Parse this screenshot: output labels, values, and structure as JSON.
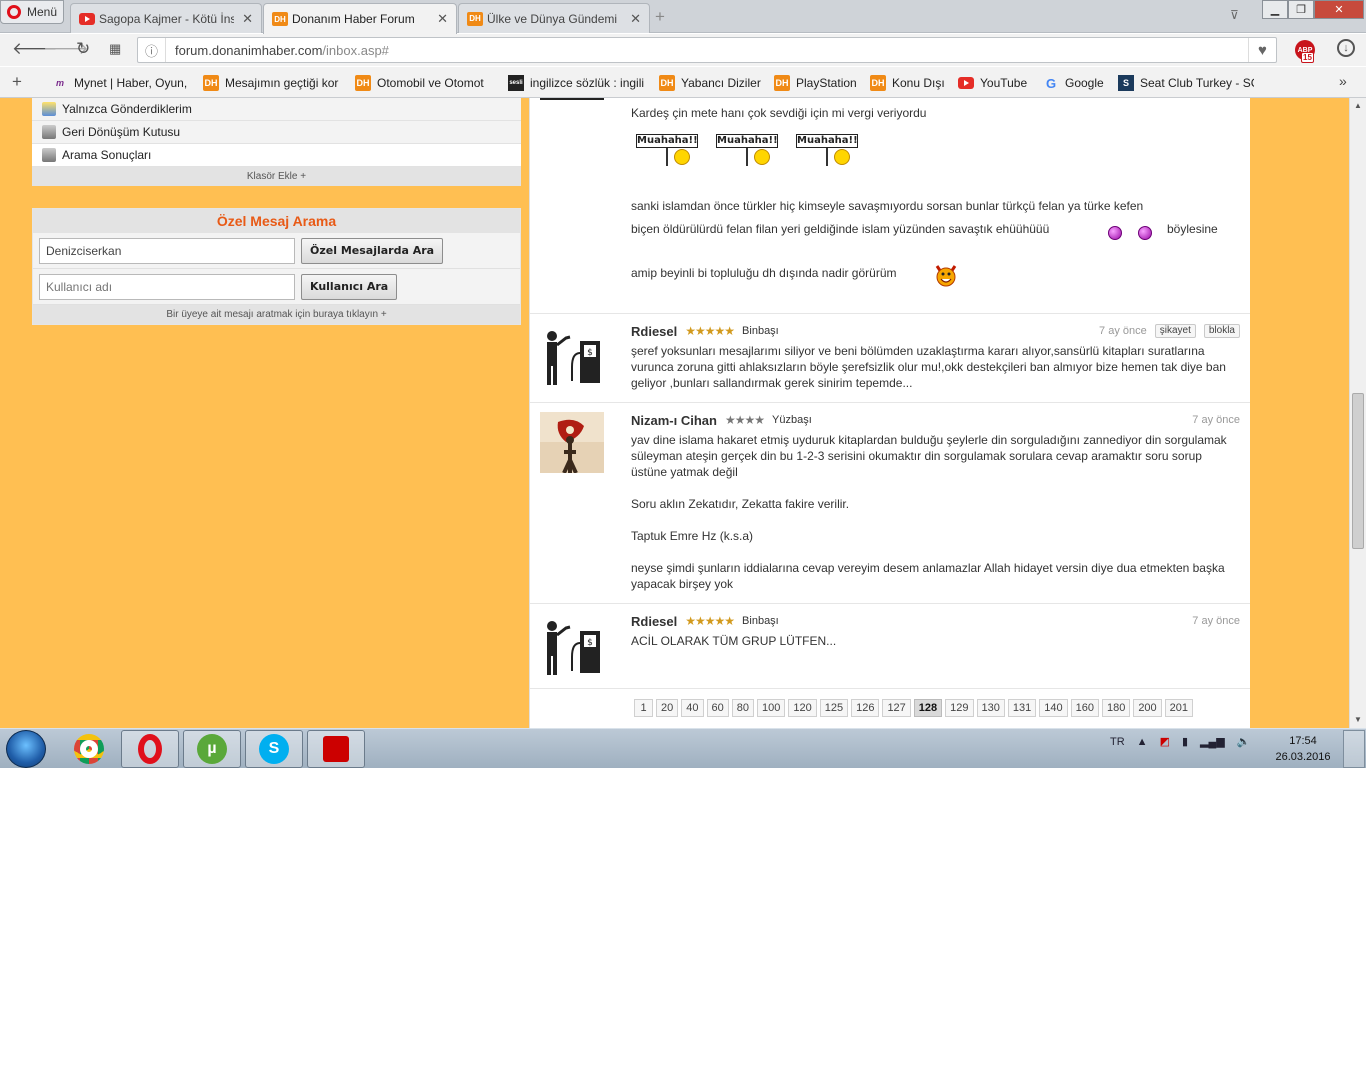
{
  "browser": {
    "menu_label": "Menü",
    "tabs": [
      {
        "label": "Sagopa Kajmer - Kötü İnsa",
        "icon": "youtube-icon"
      },
      {
        "label": "Donanım Haber Forum",
        "icon": "dh-icon",
        "active": true
      },
      {
        "label": "Ülke ve Dünya Gündemi",
        "icon": "dh-icon"
      }
    ],
    "address": {
      "host": "forum.donanimhaber.com",
      "path": "/inbox.asp#"
    },
    "adblock_count": "15",
    "bookmarks": [
      {
        "label": "Mynet | Haber, Oyun,",
        "icon": "mynet-icon"
      },
      {
        "label": "Mesajımın geçtiği kor",
        "icon": "dh-icon"
      },
      {
        "label": "Otomobil ve Otomot",
        "icon": "dh-icon"
      },
      {
        "label": "ingilizce sözlük : ingili",
        "icon": "seslisozluk-icon"
      },
      {
        "label": "Yabancı Diziler",
        "icon": "dh-icon"
      },
      {
        "label": "PlayStation",
        "icon": "dh-icon"
      },
      {
        "label": "Konu Dışı",
        "icon": "dh-icon"
      },
      {
        "label": "YouTube",
        "icon": "youtube-icon"
      },
      {
        "label": "Google",
        "icon": "google-icon"
      },
      {
        "label": "Seat Club Turkey - SC",
        "icon": "seat-icon"
      }
    ]
  },
  "sidebar": {
    "folders": [
      "Yalnızca Gönderdiklerim",
      "Geri Dönüşüm Kutusu",
      "Arama Sonuçları"
    ],
    "add_folder": "Klasör Ekle +",
    "search": {
      "title": "Özel Mesaj Arama",
      "query_value": "Denizciserkan",
      "search_button": "Özel Mesajlarda Ara",
      "user_placeholder": "Kullanıcı adı",
      "user_button": "Kullanıcı Ara",
      "hint": "Bir üyeye ait mesajı aratmak için buraya tıklayın +"
    }
  },
  "messages": [
    {
      "text_lines": [
        "Kardeş çin mete hanı çok sevdiği için mi vergi veriyordu",
        "sanki islamdan önce türkler hiç kimseyle savaşmıyordu sorsan bunlar türkçü felan ya türke kefen",
        "biçen öldürülürdü felan filan yeri geldiğinde islam yüzünden savaştık ehüühüüü",
        "böylesine",
        "amip beyinli bi topluluğu dh dışında nadir görürüm"
      ],
      "smiley_sign": "Muahaha!!"
    },
    {
      "user": "Rdiesel",
      "stars": "★★★★★",
      "rank": "Binbaşı",
      "date": "7 ay önce",
      "actions": [
        "şikayet",
        "blokla"
      ],
      "text": "şeref yoksunları mesajlarımı siliyor ve beni bölümden uzaklaştırma kararı alıyor,sansürlü kitapları suratlarına vurunca zoruna gitti ahlaksızların böyle şerefsizlik olur mu!,okk destekçileri ban almıyor bize hemen tak diye ban geliyor ,bunları sallandırmak gerek sinirim tepemde..."
    },
    {
      "user": "Nizam-ı Cihan",
      "stars": "★★★★",
      "rank": "Yüzbaşı",
      "date": "7 ay önce",
      "paragraphs": [
        "yav dine islama hakaret etmiş uyduruk kitaplardan bulduğu şeylerle din sorguladığını zannediyor din sorgulamak süleyman ateşin gerçek din bu 1-2-3 serisini okumaktır din sorgulamak sorulara cevap aramaktır soru sorup üstüne yatmak değil",
        "Soru aklın Zekatıdır, Zekatta fakire verilir.",
        "Taptuk Emre Hz (k.s.a)",
        "neyse şimdi şunların iddialarına cevap vereyim desem anlamazlar Allah hidayet versin diye dua etmekten başka yapacak birşey yok"
      ]
    },
    {
      "user": "Rdiesel",
      "stars": "★★★★★",
      "rank": "Binbaşı",
      "date": "7 ay önce",
      "text": "ACİL OLARAK TÜM GRUP LÜTFEN..."
    }
  ],
  "pagination": [
    "1",
    "20",
    "40",
    "60",
    "80",
    "100",
    "120",
    "125",
    "126",
    "127",
    "128",
    "129",
    "130",
    "131",
    "140",
    "160",
    "180",
    "200",
    "201"
  ],
  "current_page": "128",
  "taskbar": {
    "language": "TR",
    "time": "17:54",
    "date": "26.03.2016",
    "apps": [
      "chrome-icon",
      "opera-icon",
      "utorrent-icon",
      "skype-icon",
      "acrobat-icon"
    ]
  }
}
